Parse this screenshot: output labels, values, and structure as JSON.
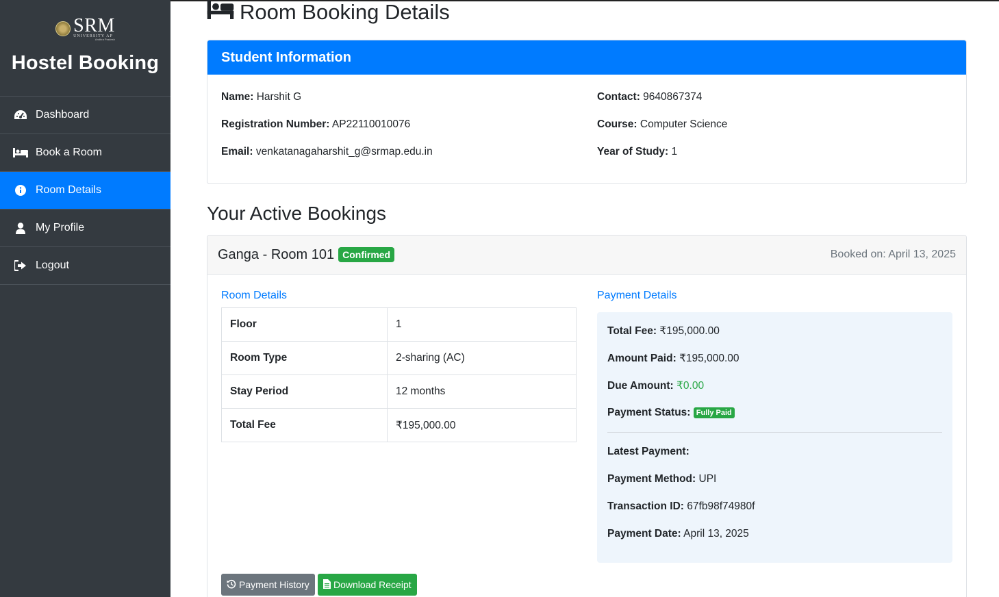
{
  "sidebar": {
    "logo_text": "SRM",
    "logo_sub": "UNIVERSITY AP",
    "logo_sub2": "Andhra Pradesh",
    "title": "Hostel Booking",
    "items": [
      {
        "label": "Dashboard",
        "icon": "tachometer-icon"
      },
      {
        "label": "Book a Room",
        "icon": "bed-icon"
      },
      {
        "label": "Room Details",
        "icon": "info-circle-icon",
        "active": true
      },
      {
        "label": "My Profile",
        "icon": "user-icon"
      },
      {
        "label": "Logout",
        "icon": "sign-out-icon"
      }
    ]
  },
  "page": {
    "title": "Room Booking Details"
  },
  "student": {
    "header": "Student Information",
    "name_label": "Name:",
    "name": "Harshit G",
    "reg_label": "Registration Number:",
    "reg": "AP22110010076",
    "email_label": "Email:",
    "email": "venkatanagaharshit_g@srmap.edu.in",
    "contact_label": "Contact:",
    "contact": "9640867374",
    "course_label": "Course:",
    "course": "Computer Science",
    "year_label": "Year of Study:",
    "year": "1"
  },
  "bookings": {
    "title": "Your Active Bookings",
    "room_name": "Ganga - Room 101",
    "status": "Confirmed",
    "booked_on": "Booked on: April 13, 2025",
    "room_details_title": "Room Details",
    "room_rows": [
      {
        "key": "Floor",
        "value": "1"
      },
      {
        "key": "Room Type",
        "value": "2-sharing (AC)"
      },
      {
        "key": "Stay Period",
        "value": "12 months"
      },
      {
        "key": "Total Fee",
        "value": "₹195,000.00"
      }
    ],
    "payment_details_title": "Payment Details",
    "payment": {
      "total_fee_label": "Total Fee:",
      "total_fee": "₹195,000.00",
      "amount_paid_label": "Amount Paid:",
      "amount_paid": "₹195,000.00",
      "due_label": "Due Amount:",
      "due": "₹0.00",
      "status_label": "Payment Status:",
      "status": "Fully Paid",
      "latest_label": "Latest Payment:",
      "method_label": "Payment Method:",
      "method": "UPI",
      "txn_label": "Transaction ID:",
      "txn": "67fb98f74980f",
      "date_label": "Payment Date:",
      "date": "April 13, 2025"
    },
    "btn_history": "Payment History",
    "btn_receipt": "Download Receipt"
  },
  "colors": {
    "sidebar_bg": "#343a40",
    "primary": "#007bff",
    "success": "#28a745",
    "secondary": "#6c757d",
    "payment_bg": "#eef5fc"
  }
}
